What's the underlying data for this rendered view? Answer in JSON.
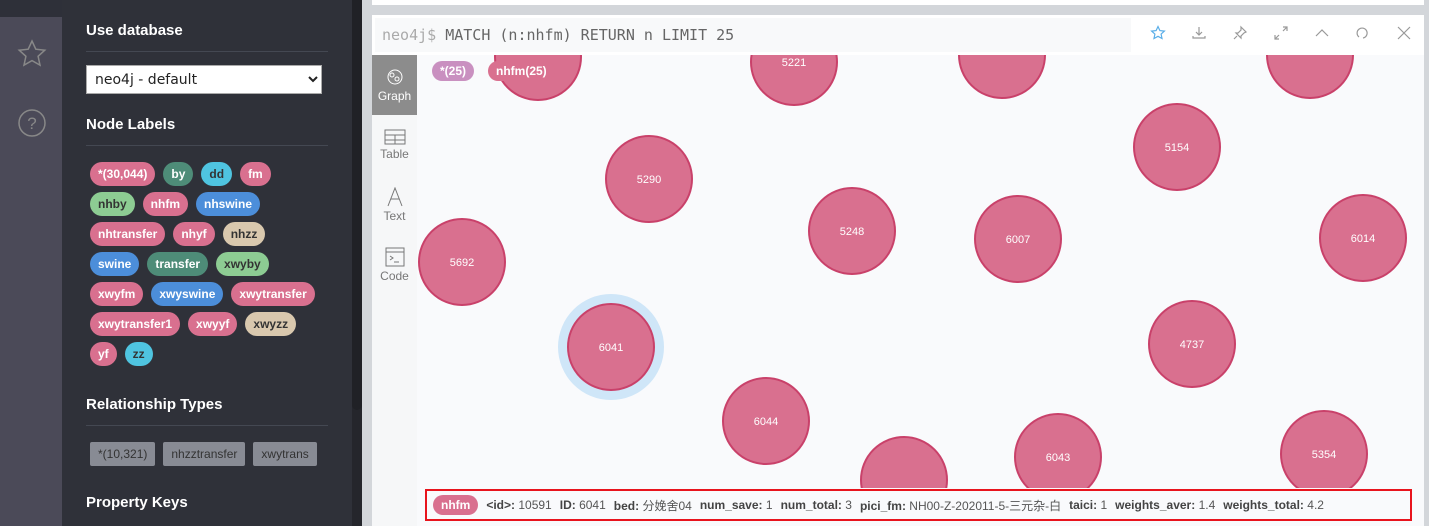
{
  "iconbar": {
    "icons": [
      "star-icon",
      "help-icon"
    ]
  },
  "sidebar": {
    "db_heading": "Use database",
    "db_selected": "neo4j - default",
    "labels_heading": "Node Labels",
    "labels": [
      {
        "t": "*(30,044)",
        "c": "#d9708f"
      },
      {
        "t": "by",
        "c": "#4e8c78"
      },
      {
        "t": "dd",
        "c": "#4fc4e0",
        "d": 1
      },
      {
        "t": "fm",
        "c": "#d9708f"
      },
      {
        "t": "nhby",
        "c": "#8dcc93",
        "d": 1
      },
      {
        "t": "nhfm",
        "c": "#d9708f"
      },
      {
        "t": "nhswine",
        "c": "#4c8eda"
      },
      {
        "t": "nhtransfer",
        "c": "#d9708f"
      },
      {
        "t": "nhyf",
        "c": "#d9708f"
      },
      {
        "t": "nhzz",
        "c": "#d9c8ae",
        "d": 1
      },
      {
        "t": "swine",
        "c": "#4c8eda"
      },
      {
        "t": "transfer",
        "c": "#4e8c78"
      },
      {
        "t": "xwyby",
        "c": "#8dcc93",
        "d": 1
      },
      {
        "t": "xwyfm",
        "c": "#d9708f"
      },
      {
        "t": "xwyswine",
        "c": "#4c8eda"
      },
      {
        "t": "xwytransfer",
        "c": "#d9708f"
      },
      {
        "t": "xwytransfer1",
        "c": "#d9708f"
      },
      {
        "t": "xwyyf",
        "c": "#d9708f"
      },
      {
        "t": "xwyzz",
        "c": "#d9c8ae",
        "d": 1
      },
      {
        "t": "yf",
        "c": "#d9708f"
      },
      {
        "t": "zz",
        "c": "#4fc4e0",
        "d": 1
      }
    ],
    "rel_heading": "Relationship Types",
    "rels": [
      "*(10,321)",
      "nhzztransfer",
      "xwytrans"
    ],
    "prop_heading": "Property Keys"
  },
  "query": {
    "prompt": "neo4j$",
    "text": "MATCH (n:nhfm) RETURN n LIMIT 25"
  },
  "toolbar": [
    "star-icon",
    "download-icon",
    "pin-icon",
    "expand-icon",
    "collapse-icon",
    "refresh-icon",
    "close-icon"
  ],
  "views": [
    {
      "label": "Graph",
      "active": true
    },
    {
      "label": "Table"
    },
    {
      "label": "Text"
    },
    {
      "label": "Code"
    }
  ],
  "legend": [
    {
      "t": "*(25)",
      "c": "#c990c0"
    },
    {
      "t": "nhfm(25)",
      "c": "#d9708f"
    }
  ],
  "node_color": "#d9708f",
  "node_border": "#c9416a",
  "nodes": [
    "",
    "5221",
    "",
    "",
    "5154",
    "5290",
    "5248",
    "6007",
    "6014",
    "5692",
    "6041",
    "4737",
    "6044",
    "",
    "6043",
    "5354"
  ],
  "selected_node": "6041",
  "status": {
    "label": "nhfm",
    "props": [
      [
        "<id>:",
        "10591"
      ],
      [
        "ID:",
        "6041"
      ],
      [
        "bed:",
        "分娩舍04"
      ],
      [
        "num_save:",
        "1"
      ],
      [
        "num_total:",
        "3"
      ],
      [
        "pici_fm:",
        "NH00-Z-202011-5-三元杂-白"
      ],
      [
        "taici:",
        "1"
      ],
      [
        "weights_aver:",
        "1.4"
      ],
      [
        "weights_total:",
        "4.2"
      ]
    ]
  }
}
